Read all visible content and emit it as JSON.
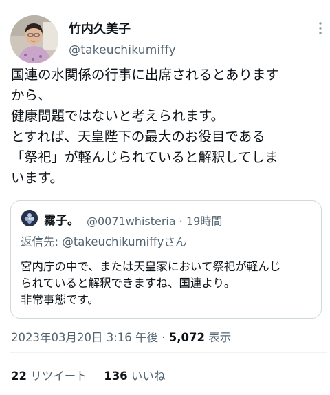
{
  "author": {
    "name": "竹内久美子",
    "handle": "@takeuchikumiffy"
  },
  "body_lines": [
    "国連の水関係の行事に出席されるとあります",
    "から、",
    "健康問題ではないと考えられます。",
    "とすれば、天皇陛下の最大のお役目である",
    "「祭祀」が軽んじられていると解釈してしま",
    "います。"
  ],
  "quote": {
    "name": "霧子。",
    "handle": "@0071whisteria",
    "separator": "·",
    "time": "19時間",
    "reply_label": "返信先:",
    "reply_to": "@takeuchikumiffyさん",
    "body_lines": [
      "宮内庁の中で、または天皇家において祭祀が軽んじ",
      "られていると解釈できますね、国連より。",
      "非常事態です。"
    ]
  },
  "meta": {
    "timestamp": "2023年03月20日 3:16 午後",
    "separator": "·",
    "views_count": "5,072",
    "views_label": "表示"
  },
  "stats": {
    "retweets_count": "22",
    "retweets_label": "リツイート",
    "likes_count": "136",
    "likes_label": "いいね"
  },
  "icons": {
    "more": "more-options-icon"
  },
  "colors": {
    "text_primary": "#0f1419",
    "text_secondary": "#536471",
    "border": "#cfd9de"
  }
}
